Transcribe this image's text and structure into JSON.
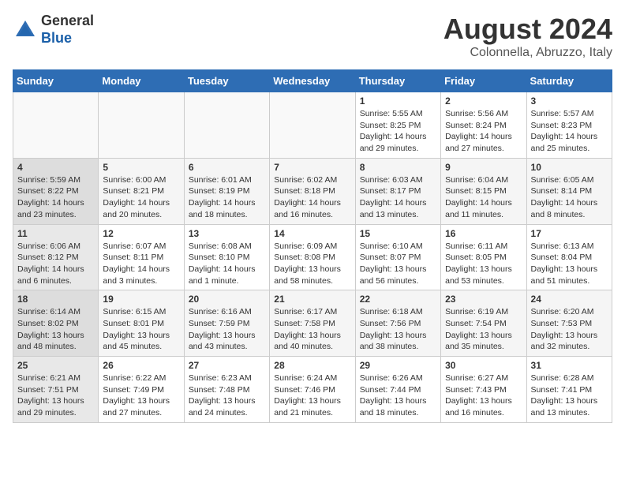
{
  "header": {
    "logo_line1": "General",
    "logo_line2": "Blue",
    "month_year": "August 2024",
    "location": "Colonnella, Abruzzo, Italy"
  },
  "weekdays": [
    "Sunday",
    "Monday",
    "Tuesday",
    "Wednesday",
    "Thursday",
    "Friday",
    "Saturday"
  ],
  "weeks": [
    [
      {
        "day": "",
        "info": ""
      },
      {
        "day": "",
        "info": ""
      },
      {
        "day": "",
        "info": ""
      },
      {
        "day": "",
        "info": ""
      },
      {
        "day": "1",
        "info": "Sunrise: 5:55 AM\nSunset: 8:25 PM\nDaylight: 14 hours\nand 29 minutes."
      },
      {
        "day": "2",
        "info": "Sunrise: 5:56 AM\nSunset: 8:24 PM\nDaylight: 14 hours\nand 27 minutes."
      },
      {
        "day": "3",
        "info": "Sunrise: 5:57 AM\nSunset: 8:23 PM\nDaylight: 14 hours\nand 25 minutes."
      }
    ],
    [
      {
        "day": "4",
        "info": "Sunrise: 5:59 AM\nSunset: 8:22 PM\nDaylight: 14 hours\nand 23 minutes."
      },
      {
        "day": "5",
        "info": "Sunrise: 6:00 AM\nSunset: 8:21 PM\nDaylight: 14 hours\nand 20 minutes."
      },
      {
        "day": "6",
        "info": "Sunrise: 6:01 AM\nSunset: 8:19 PM\nDaylight: 14 hours\nand 18 minutes."
      },
      {
        "day": "7",
        "info": "Sunrise: 6:02 AM\nSunset: 8:18 PM\nDaylight: 14 hours\nand 16 minutes."
      },
      {
        "day": "8",
        "info": "Sunrise: 6:03 AM\nSunset: 8:17 PM\nDaylight: 14 hours\nand 13 minutes."
      },
      {
        "day": "9",
        "info": "Sunrise: 6:04 AM\nSunset: 8:15 PM\nDaylight: 14 hours\nand 11 minutes."
      },
      {
        "day": "10",
        "info": "Sunrise: 6:05 AM\nSunset: 8:14 PM\nDaylight: 14 hours\nand 8 minutes."
      }
    ],
    [
      {
        "day": "11",
        "info": "Sunrise: 6:06 AM\nSunset: 8:12 PM\nDaylight: 14 hours\nand 6 minutes."
      },
      {
        "day": "12",
        "info": "Sunrise: 6:07 AM\nSunset: 8:11 PM\nDaylight: 14 hours\nand 3 minutes."
      },
      {
        "day": "13",
        "info": "Sunrise: 6:08 AM\nSunset: 8:10 PM\nDaylight: 14 hours\nand 1 minute."
      },
      {
        "day": "14",
        "info": "Sunrise: 6:09 AM\nSunset: 8:08 PM\nDaylight: 13 hours\nand 58 minutes."
      },
      {
        "day": "15",
        "info": "Sunrise: 6:10 AM\nSunset: 8:07 PM\nDaylight: 13 hours\nand 56 minutes."
      },
      {
        "day": "16",
        "info": "Sunrise: 6:11 AM\nSunset: 8:05 PM\nDaylight: 13 hours\nand 53 minutes."
      },
      {
        "day": "17",
        "info": "Sunrise: 6:13 AM\nSunset: 8:04 PM\nDaylight: 13 hours\nand 51 minutes."
      }
    ],
    [
      {
        "day": "18",
        "info": "Sunrise: 6:14 AM\nSunset: 8:02 PM\nDaylight: 13 hours\nand 48 minutes."
      },
      {
        "day": "19",
        "info": "Sunrise: 6:15 AM\nSunset: 8:01 PM\nDaylight: 13 hours\nand 45 minutes."
      },
      {
        "day": "20",
        "info": "Sunrise: 6:16 AM\nSunset: 7:59 PM\nDaylight: 13 hours\nand 43 minutes."
      },
      {
        "day": "21",
        "info": "Sunrise: 6:17 AM\nSunset: 7:58 PM\nDaylight: 13 hours\nand 40 minutes."
      },
      {
        "day": "22",
        "info": "Sunrise: 6:18 AM\nSunset: 7:56 PM\nDaylight: 13 hours\nand 38 minutes."
      },
      {
        "day": "23",
        "info": "Sunrise: 6:19 AM\nSunset: 7:54 PM\nDaylight: 13 hours\nand 35 minutes."
      },
      {
        "day": "24",
        "info": "Sunrise: 6:20 AM\nSunset: 7:53 PM\nDaylight: 13 hours\nand 32 minutes."
      }
    ],
    [
      {
        "day": "25",
        "info": "Sunrise: 6:21 AM\nSunset: 7:51 PM\nDaylight: 13 hours\nand 29 minutes."
      },
      {
        "day": "26",
        "info": "Sunrise: 6:22 AM\nSunset: 7:49 PM\nDaylight: 13 hours\nand 27 minutes."
      },
      {
        "day": "27",
        "info": "Sunrise: 6:23 AM\nSunset: 7:48 PM\nDaylight: 13 hours\nand 24 minutes."
      },
      {
        "day": "28",
        "info": "Sunrise: 6:24 AM\nSunset: 7:46 PM\nDaylight: 13 hours\nand 21 minutes."
      },
      {
        "day": "29",
        "info": "Sunrise: 6:26 AM\nSunset: 7:44 PM\nDaylight: 13 hours\nand 18 minutes."
      },
      {
        "day": "30",
        "info": "Sunrise: 6:27 AM\nSunset: 7:43 PM\nDaylight: 13 hours\nand 16 minutes."
      },
      {
        "day": "31",
        "info": "Sunrise: 6:28 AM\nSunset: 7:41 PM\nDaylight: 13 hours\nand 13 minutes."
      }
    ]
  ]
}
